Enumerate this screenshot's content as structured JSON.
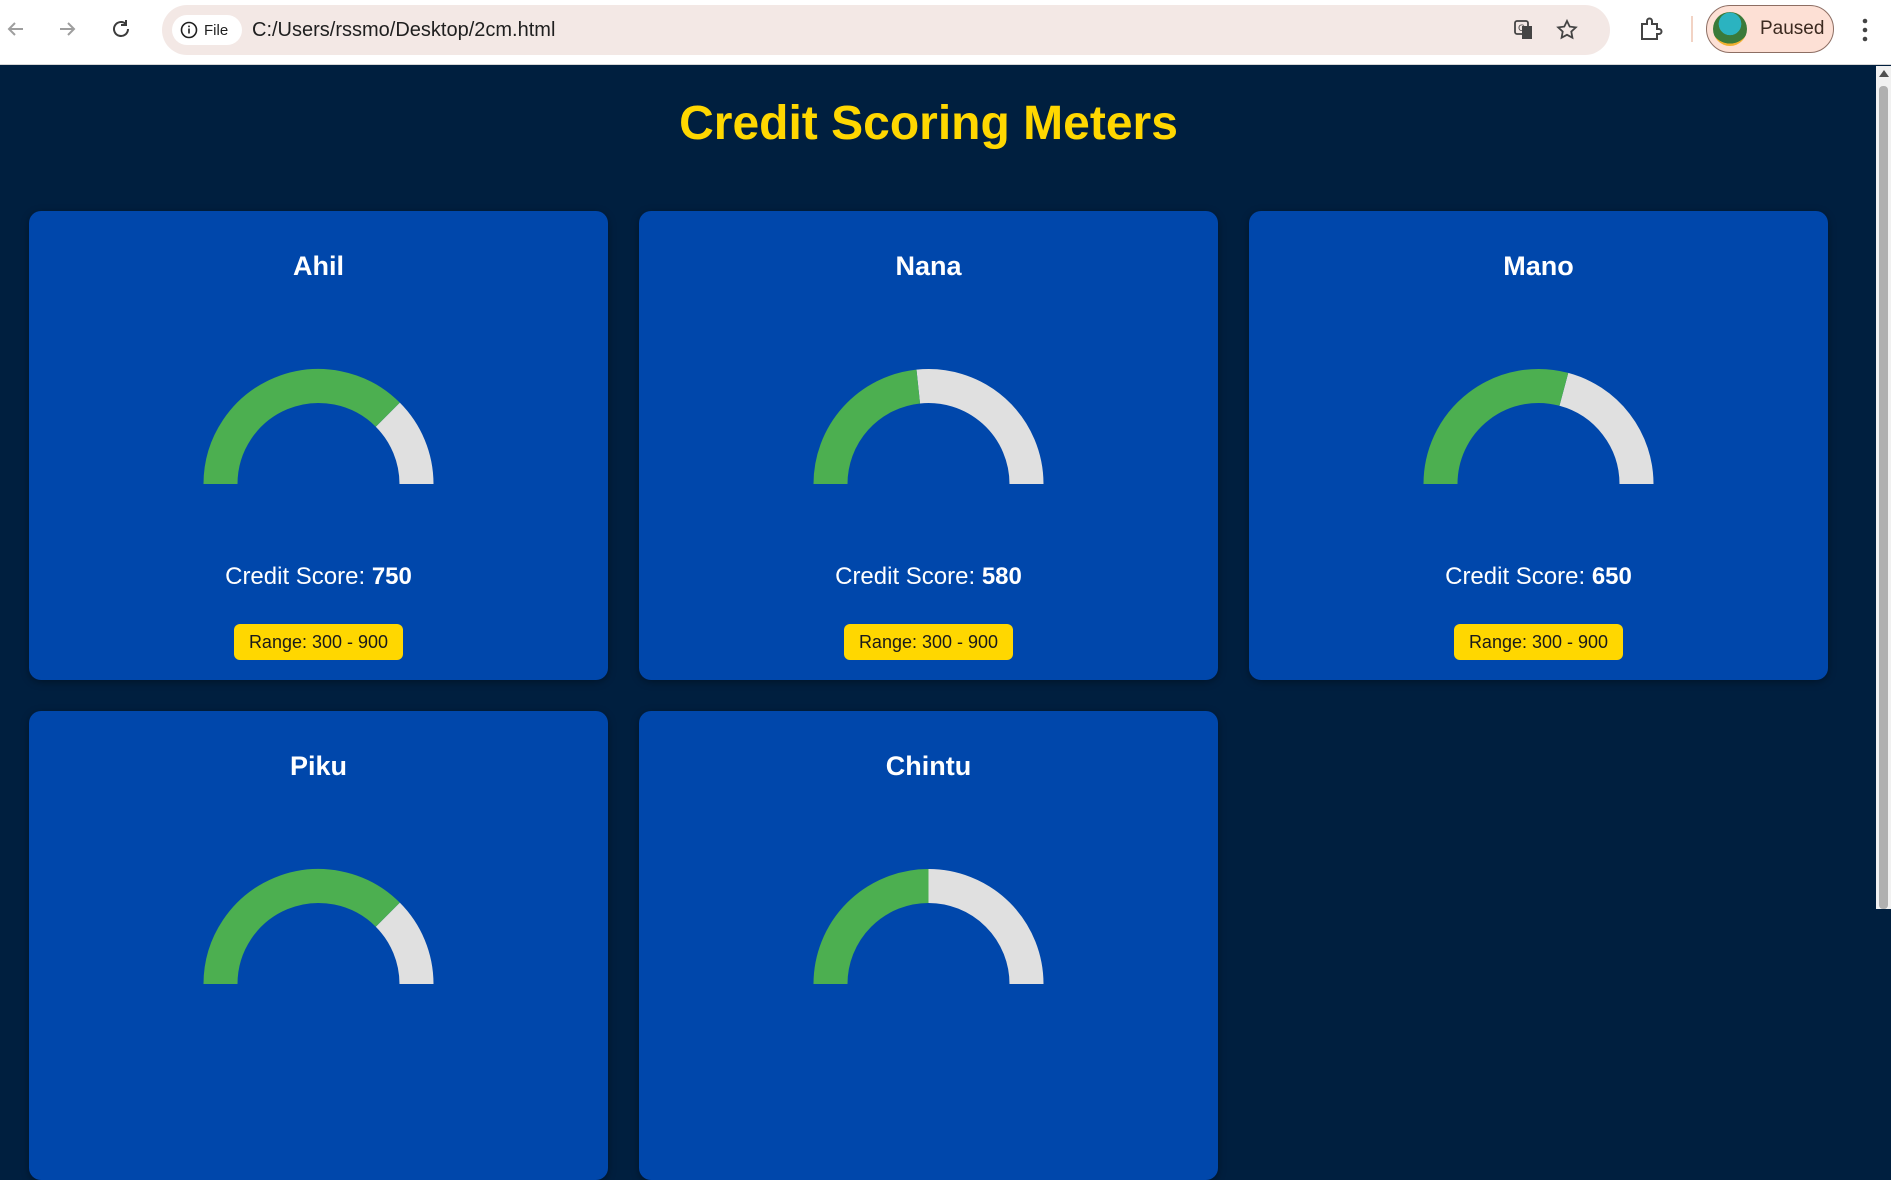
{
  "browser": {
    "url": "C:/Users/rssmo/Desktop/2cm.html",
    "file_chip_label": "File",
    "profile_label": "Paused"
  },
  "page": {
    "title": "Credit Scoring Meters",
    "score_prefix": "Credit Score: ",
    "gauge": {
      "min": 300,
      "max": 900,
      "fill_color": "#4caf50",
      "track_color": "#e0e0e0"
    }
  },
  "cards": [
    {
      "name": "Ahil",
      "score": "750",
      "range": "Range: 300 - 900"
    },
    {
      "name": "Nana",
      "score": "580",
      "range": "Range: 300 - 900"
    },
    {
      "name": "Mano",
      "score": "650",
      "range": "Range: 300 - 900"
    },
    {
      "name": "Piku",
      "score": "",
      "range": ""
    },
    {
      "name": "Chintu",
      "score": "",
      "range": ""
    }
  ],
  "partial_gauge_fraction": {
    "Piku": 0.75,
    "Chintu": 0.5
  }
}
